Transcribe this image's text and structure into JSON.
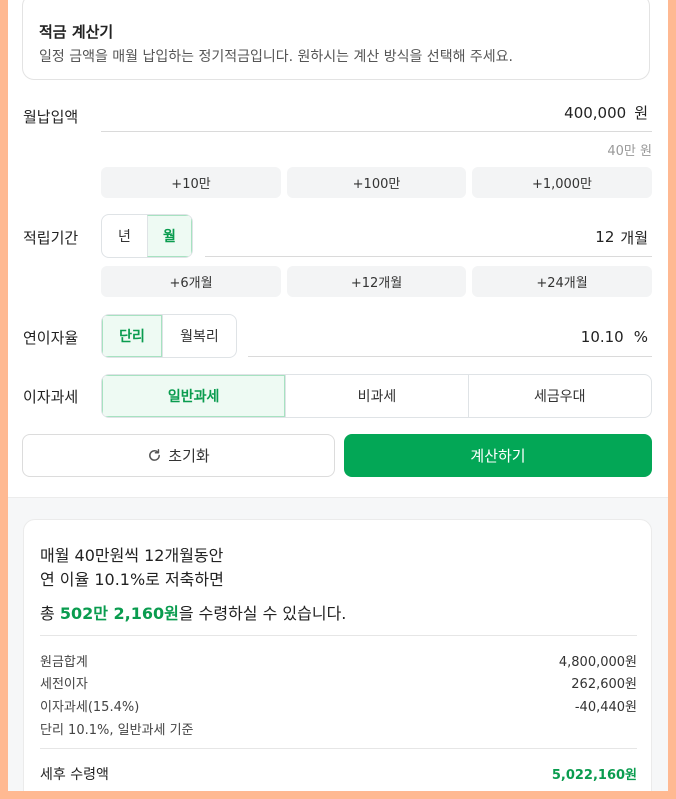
{
  "intro": {
    "title": "적금 계산기",
    "description": "일정 금액을 매월 납입하는 정기적금입니다. 원하시는 계산 방식을 선택해 주세요."
  },
  "monthly_deposit": {
    "label": "월납입액",
    "value": "400,000",
    "unit": "원",
    "hint": "40만 원",
    "quick_add": [
      "+10만",
      "+100만",
      "+1,000만"
    ]
  },
  "period": {
    "label": "적립기간",
    "unit_options": [
      "년",
      "월"
    ],
    "selected_unit": "월",
    "value": "12",
    "unit": "개월",
    "quick_add": [
      "+6개월",
      "+12개월",
      "+24개월"
    ]
  },
  "rate": {
    "label": "연이자율",
    "options": [
      "단리",
      "월복리"
    ],
    "selected": "단리",
    "value": "10.10",
    "unit": "%"
  },
  "tax": {
    "label": "이자과세",
    "options": [
      "일반과세",
      "비과세",
      "세금우대"
    ],
    "selected": "일반과세"
  },
  "actions": {
    "reset_label": "초기화",
    "calculate_label": "계산하기"
  },
  "result": {
    "line1": "매월 40만원씩 12개월동안",
    "line2": "연 이율 10.1%로 저축하면",
    "total_prefix": "총 ",
    "total_amount": "502만 2,160원",
    "total_suffix": "을 수령하실 수 있습니다.",
    "details": [
      {
        "label": "원금합계",
        "value": "4,800,000원"
      },
      {
        "label": "세전이자",
        "value": "262,600원"
      },
      {
        "label": "이자과세(15.4%)",
        "value": "-40,440원"
      }
    ],
    "basis": "단리 10.1%, 일반과세 기준",
    "after_tax_label": "세후 수령액",
    "after_tax_value": "5,022,160원"
  },
  "colors": {
    "accent": "#03a756",
    "accent_text": "#0a9c4f",
    "frame": "#ffb992"
  }
}
